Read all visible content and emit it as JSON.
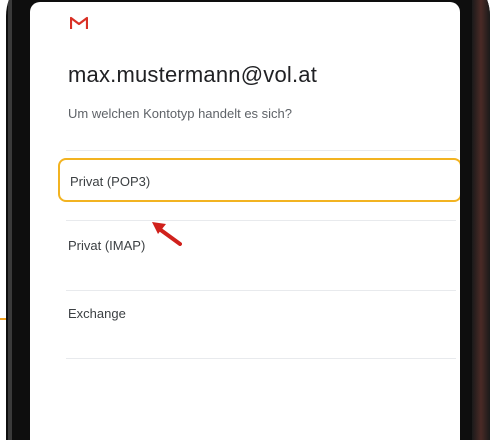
{
  "app": {
    "logo_icon": "gmail-m-icon",
    "account_email": "max.mustermann@vol.at",
    "question": "Um welchen Kontotyp handelt es sich?"
  },
  "options": [
    {
      "label": "Privat (POP3)",
      "highlighted": true
    },
    {
      "label": "Privat (IMAP)",
      "highlighted": false
    },
    {
      "label": "Exchange",
      "highlighted": false
    }
  ],
  "annotation": {
    "arrow_icon": "red-pointer-arrow-icon",
    "arrow_color": "#d0211c",
    "highlight_color": "#f2b321"
  }
}
